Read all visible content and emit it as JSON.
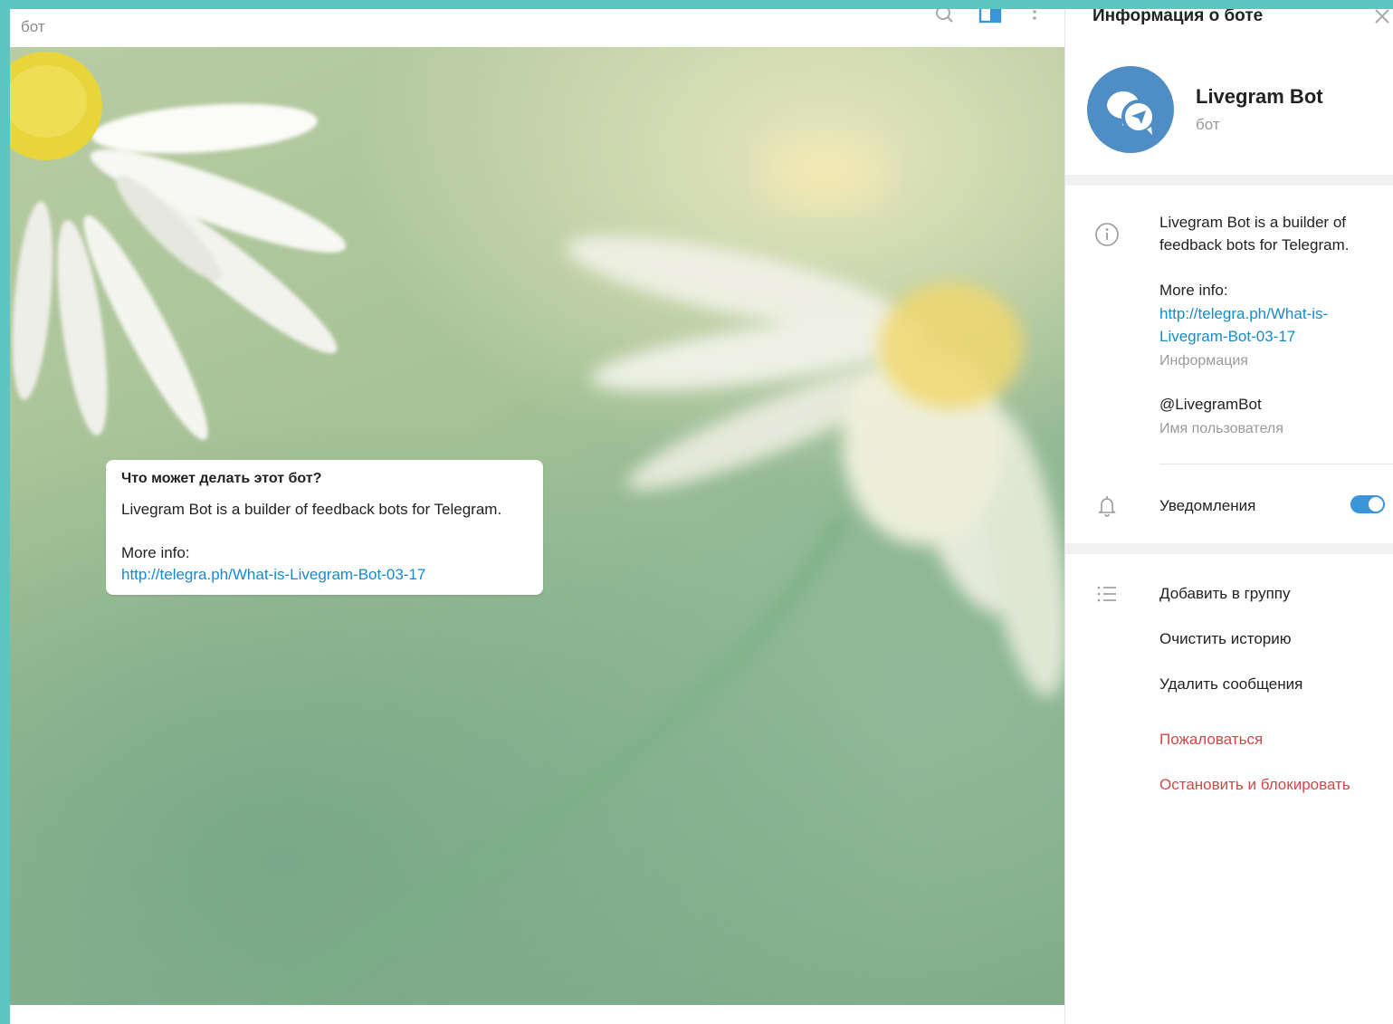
{
  "colors": {
    "accent": "#3a95d8",
    "link": "#168acd",
    "danger": "#d14747",
    "avatar": "#4f8ec4",
    "frame": "#5cc6c0"
  },
  "chat": {
    "status": "бот",
    "header_icons": [
      "search-icon",
      "sidebar-toggle-icon",
      "more-vertical-icon"
    ],
    "bot_card": {
      "question": "Что может делать этот бот?",
      "description": "Livegram Bot is a builder of feedback bots for Telegram.",
      "more_info_label": "More info:",
      "link": "http://telegra.ph/What-is-Livegram-Bot-03-17"
    }
  },
  "panel": {
    "title": "Информация о боте",
    "close_icon": "close-icon",
    "bot_name": "Livegram Bot",
    "bot_type": "бот",
    "about": {
      "icon": "info-icon",
      "line1": "Livegram Bot is a builder of",
      "line2": "feedback bots for Telegram.",
      "more_info_label": "More info:",
      "link_line1": "http://telegra.ph/What-is-",
      "link_line2": "Livegram-Bot-03-17",
      "caption": "Информация"
    },
    "username": {
      "value": "@LivegramBot",
      "caption": "Имя пользователя"
    },
    "notifications": {
      "icon": "bell-icon",
      "label": "Уведомления",
      "enabled": true
    },
    "actions": {
      "icon": "list-icon",
      "add_to_group": "Добавить в группу",
      "clear_history": "Очистить историю",
      "delete_messages": "Удалить сообщения",
      "report": "Пожаловаться",
      "stop_and_block": "Остановить и блокировать"
    }
  }
}
